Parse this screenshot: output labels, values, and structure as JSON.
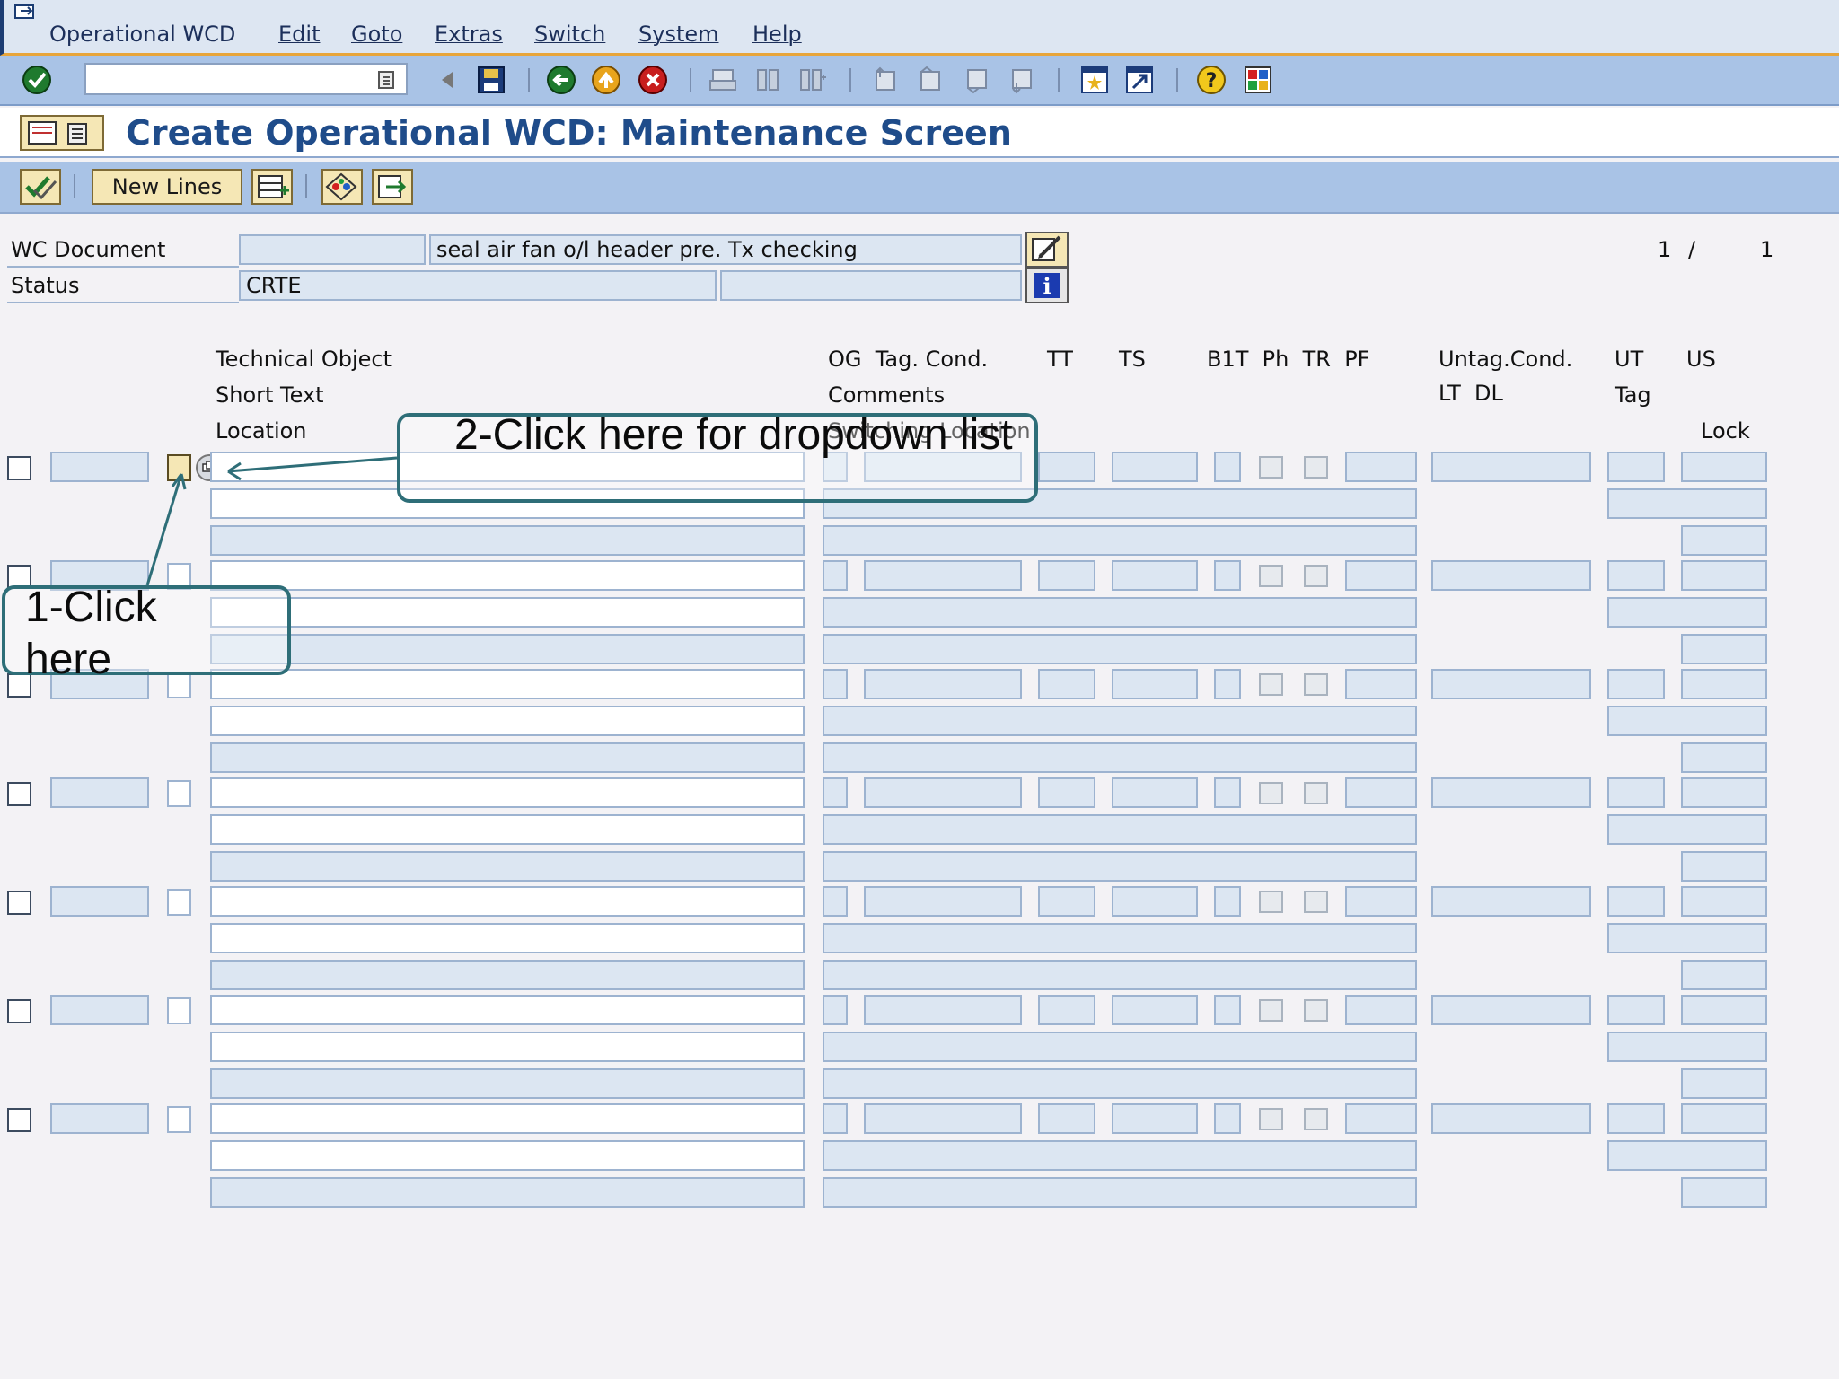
{
  "menu": {
    "items": [
      "Operational WCD",
      "Edit",
      "Goto",
      "Extras",
      "Switch",
      "System",
      "Help"
    ]
  },
  "toolbar": {
    "command_field_value": "",
    "icons": [
      "enter-icon",
      "back-icon",
      "save-icon",
      "back-green-icon",
      "exit-icon",
      "cancel-icon",
      "print-icon",
      "find-icon",
      "find-next-icon",
      "first-page-icon",
      "prev-page-icon",
      "next-page-icon",
      "last-page-icon",
      "create-session-icon",
      "shortcut-icon",
      "help-icon",
      "layout-icon"
    ]
  },
  "title": "Create Operational WCD: Maintenance Screen",
  "app_toolbar": {
    "new_lines_label": "New Lines"
  },
  "header": {
    "wc_document_label": "WC Document",
    "wc_document_value": "",
    "wc_document_text": "seal air fan o/l header pre. Tx checking",
    "status_label": "Status",
    "status_value": "CRTE",
    "status_extra": "",
    "page_current": "1",
    "page_sep": "/",
    "page_total": "1"
  },
  "columns": {
    "technical_object": "Technical Object",
    "short_text": "Short Text",
    "location": "Location",
    "og_tag_cond": "OG  Tag. Cond.",
    "comments": "Comments",
    "switching_location": "Switching Location",
    "tt": "TT",
    "ts": "TS",
    "bt_ph_tr_pf": "B1T  Ph  TR  PF",
    "untag_cond": "Untag.Cond.",
    "lt_dl": "LT  DL",
    "ut": "UT",
    "us": "US",
    "tag": "Tag",
    "lock": "Lock"
  },
  "row_count": 7,
  "callouts": {
    "step1": "1-Click here",
    "step2": "2-Click here for dropdown list"
  },
  "colors": {
    "menubar_bg": "#dde6f2",
    "toolbar_bg": "#a9c3e6",
    "title_color": "#1f4c8a",
    "field_bg": "#dce6f2",
    "callout_border": "#2e6e78"
  }
}
